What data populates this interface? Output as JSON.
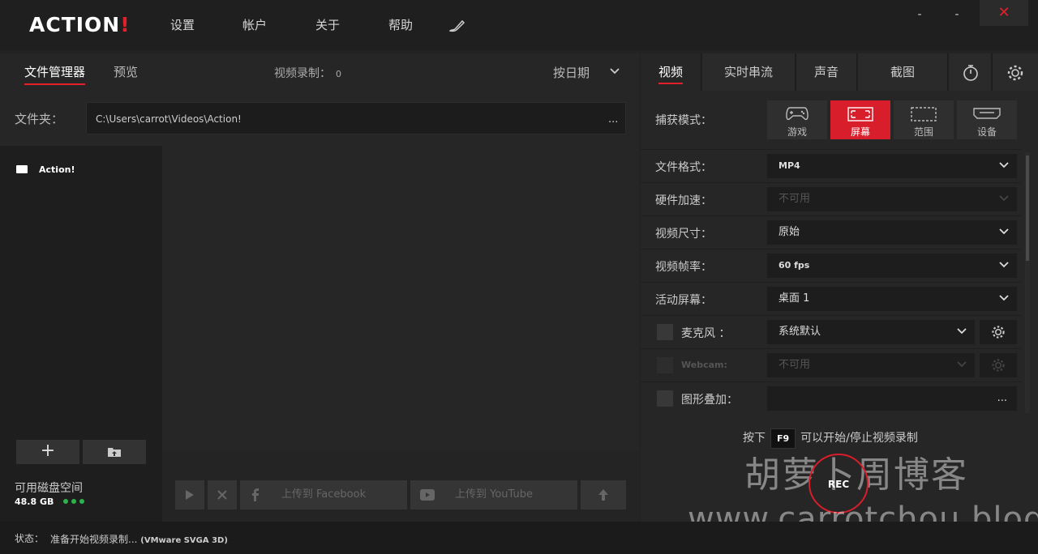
{
  "app": {
    "logo_main": "ACTION",
    "logo_bang": "!"
  },
  "menu": {
    "settings": "设置",
    "account": "帐户",
    "about": "关于",
    "help": "帮助"
  },
  "window": {
    "minimize": "-",
    "maximize": "-",
    "close": "✕"
  },
  "left": {
    "tab_files": "文件管理器",
    "tab_preview": "预览",
    "rec_count_label": "视频录制：",
    "rec_count_value": "0",
    "sort_label": "按日期",
    "folder_label": "文件夹：",
    "folder_path": "C:\\Users\\carrot\\Videos\\Action!",
    "folder_more": "...",
    "tree_item": "Action!",
    "add_label": "+",
    "disk_label": "可用磁盘空间",
    "disk_value": "48.8 GB",
    "upload_facebook": "上传到 Facebook",
    "upload_youtube": "上传到 YouTube"
  },
  "right": {
    "tabs": [
      "视频",
      "实时串流",
      "声音",
      "截图"
    ],
    "capture_label": "捕获模式：",
    "capture_modes": [
      "游戏",
      "屏幕",
      "范围",
      "设备"
    ],
    "rows": {
      "format_label": "文件格式：",
      "format_value": "MP4",
      "hw_label": "硬件加速：",
      "hw_value": "不可用",
      "size_label": "视频尺寸：",
      "size_value": "原始",
      "fps_label": "视频帧率：",
      "fps_value": "60 fps",
      "screen_label": "活动屏幕：",
      "screen_value": "桌面 1",
      "mic_label": "麦克风 ：",
      "mic_value": "系统默认",
      "webcam_label": "Webcam:",
      "webcam_value": "不可用",
      "overlay_label": "图形叠加：",
      "overlay_value": "..."
    },
    "hint_pre": "按下",
    "hint_key": "F9",
    "hint_post": "可以开始/停止视频录制",
    "rec_label": "REC"
  },
  "watermark": {
    "line1": "胡萝卜周博客",
    "line2": "www.carrotchou.blog"
  },
  "status": {
    "label": "状态：",
    "text": "准备开始视频录制...",
    "detail": "(VMware SVGA 3D)"
  },
  "colors": {
    "accent": "#d81e2a",
    "disk_dots": "#2cb34a"
  }
}
